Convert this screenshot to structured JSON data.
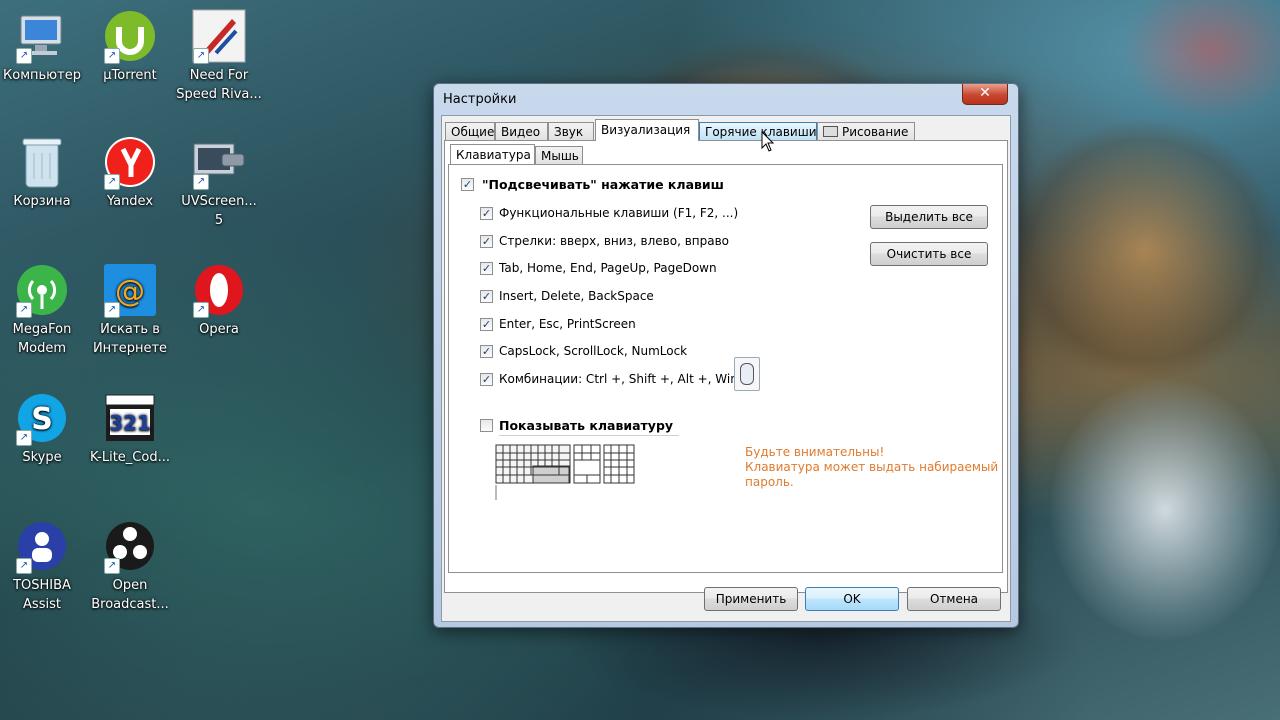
{
  "desktop": {
    "icons": [
      {
        "label": "Компьютер",
        "icon": "computer-icon"
      },
      {
        "label": "µTorrent",
        "icon": "utorrent-icon"
      },
      {
        "label": "Need For Speed Riva...",
        "icon": "nfs-icon"
      },
      {
        "label": "Корзина",
        "icon": "recycle-bin-icon"
      },
      {
        "label": "Yandex",
        "icon": "yandex-icon"
      },
      {
        "label": "UVScreen... 5",
        "icon": "uvscreen-icon"
      },
      {
        "label": "MegaFon Modem",
        "icon": "megafon-icon"
      },
      {
        "label": "Искать в Интернете",
        "icon": "mail-search-icon"
      },
      {
        "label": "Opera",
        "icon": "opera-icon"
      },
      {
        "label": "Skype",
        "icon": "skype-icon"
      },
      {
        "label": "K-Lite_Cod...",
        "icon": "klite-icon"
      },
      {
        "label": "TOSHIBA Assist",
        "icon": "toshiba-icon"
      },
      {
        "label": "Open Broadcast...",
        "icon": "obs-icon"
      }
    ]
  },
  "dialog": {
    "title": "Настройки",
    "close_label": "✕",
    "tabs": [
      "Общие",
      "Видео",
      "Звук",
      "Визуализация",
      "Горячие клавиши",
      "Рисование"
    ],
    "active_tab": "Визуализация",
    "subtabs": [
      "Клавиатура",
      "Мышь"
    ],
    "active_subtab": "Клавиатура",
    "highlight_keys": {
      "label": "\"Подсвечивать\" нажатие клавиш",
      "checked": true
    },
    "key_options": [
      {
        "label": "Функциональные клавиши (F1, F2, ...)",
        "checked": true
      },
      {
        "label": "Стрелки: вверх, вниз, влево, вправо",
        "checked": true
      },
      {
        "label": "Tab, Home, End, PageUp, PageDown",
        "checked": true
      },
      {
        "label": "Insert, Delete, BackSpace",
        "checked": true
      },
      {
        "label": "Enter, Esc, PrintScreen",
        "checked": true
      },
      {
        "label": "CapsLock, ScrollLock, NumLock",
        "checked": true
      },
      {
        "label": "Комбинации: Ctrl +, Shift +, Alt +, Win +",
        "checked": true
      }
    ],
    "select_all": "Выделить все",
    "clear_all": "Очистить все",
    "show_keyboard": {
      "label": "Показывать клавиатуру",
      "checked": false
    },
    "warning_lines": [
      "Будьте внимательны!",
      "Клавиатура может выдать набираемый",
      "пароль."
    ],
    "buttons": {
      "apply": "Применить",
      "ok": "OK",
      "cancel": "Отмена"
    },
    "check_glyph": "✓"
  }
}
